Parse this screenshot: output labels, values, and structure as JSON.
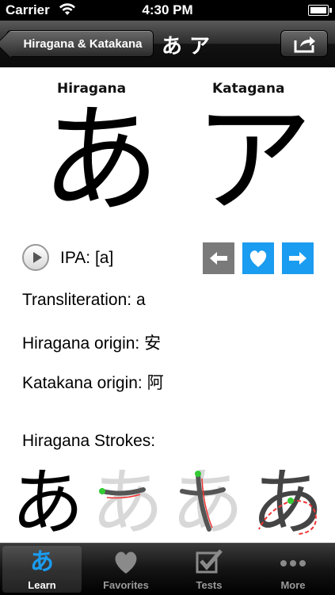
{
  "status_bar": {
    "carrier": "Carrier",
    "time": "4:30 PM"
  },
  "nav": {
    "back_label": "Hiragana & Katakana",
    "title": "あ ア",
    "share_icon": "share-icon"
  },
  "hiragana_label": "Hiragana",
  "katakana_label": "Katagana",
  "hiragana_char": "あ",
  "katakana_char": "ア",
  "ipa": "IPA: [a]",
  "transliteration": "Transliteration: a",
  "hiragana_origin": "Hiragana origin: 安",
  "katakana_origin": "Katakana origin: 阿",
  "strokes_title": "Hiragana Strokes:",
  "strokes": [
    "あ",
    "あ",
    "あ",
    "あ"
  ],
  "colors": {
    "accent_blue": "#1a9cf0",
    "gray_button": "#7a7a7a",
    "stroke_red": "#ee3333",
    "stroke_green": "#33cc33"
  },
  "tabs": [
    {
      "label": "Learn",
      "icon": "learn-icon"
    },
    {
      "label": "Favorites",
      "icon": "heart-icon"
    },
    {
      "label": "Tests",
      "icon": "checkbox-icon"
    },
    {
      "label": "More",
      "icon": "more-icon"
    }
  ]
}
